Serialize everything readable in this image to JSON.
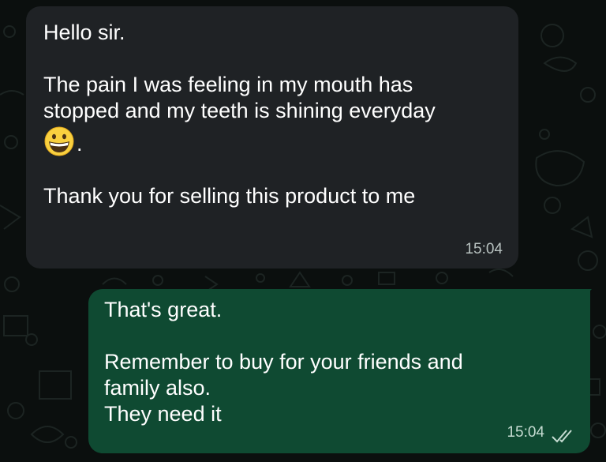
{
  "chat": {
    "incoming": {
      "greeting": "Hello sir.",
      "line1": "The pain I was feeling in my mouth has",
      "line2": "stopped and my teeth is shining everyday",
      "emoji_icon": "grinning-face-icon",
      "emoji_suffix": ".",
      "line3": "Thank you for selling this product to me",
      "time": "15:04"
    },
    "outgoing": {
      "line1": "That's great.",
      "line2": "Remember to buy for your friends and",
      "line3": "family also.",
      "line4": "They need it",
      "time": "15:04",
      "status_icon": "double-check-icon"
    }
  },
  "colors": {
    "background": "#0b0f0e",
    "incoming_bubble": "#1f2225",
    "outgoing_bubble": "#0f4a32",
    "text": "#ffffff",
    "timestamp": "#b8c2c0"
  }
}
